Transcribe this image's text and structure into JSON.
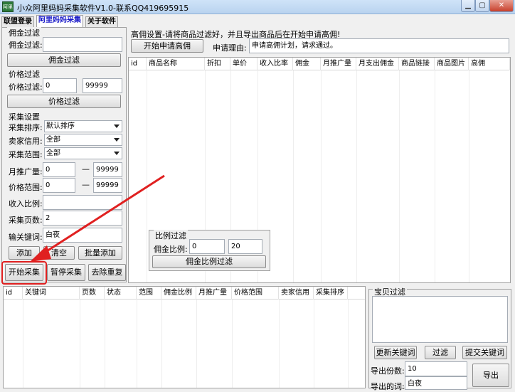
{
  "window": {
    "title": "小众阿里妈妈采集软件V1.0-联系QQ419695915",
    "icon_text": "阿里"
  },
  "tabs": [
    "联盟登录",
    "阿里妈妈采集",
    "关于软件"
  ],
  "commission_filter": {
    "group": "佣金过滤",
    "label": "佣金过滤:",
    "value": "",
    "button": "佣金过滤"
  },
  "price_filter": {
    "group": "价格过滤",
    "label": "价格过滤:",
    "min": "0",
    "max": "99999",
    "button": "价格过滤"
  },
  "collect_settings": {
    "group": "采集设置",
    "sort_label": "采集排序:",
    "sort_value": "默认排序",
    "credit_label": "卖家信用:",
    "credit_value": "全部",
    "scope_label": "采集范围:",
    "scope_value": "全部",
    "promo_label": "月推广量:",
    "promo_min": "0",
    "promo_max": "99999",
    "price_label": "价格范围:",
    "price_min": "0",
    "price_max": "99999",
    "dash": "—",
    "ratio_label": "收入比例:",
    "ratio_value": "",
    "pages_label": "采集页数:",
    "pages_value": "2",
    "keyword_label": "输关键词:",
    "keyword_value": "白夜",
    "add_button": "添加",
    "clear_button": "清空",
    "batch_add_button": "批量添加",
    "start_button": "开始采集",
    "pause_button": "暂停采集",
    "dedupe_button": "去除重复"
  },
  "high_commission": {
    "notice": "高佣设置-请将商品过滤好，并且导出商品后在开始申请高佣!",
    "apply_button": "开始申请高佣",
    "reason_label": "申请理由:",
    "reason_value": "申请高佣计划，请求通过。"
  },
  "product_table": {
    "columns": [
      "id",
      "商品名称",
      "折扣",
      "单价",
      "收入比率",
      "佣金",
      "月推广量",
      "月支出佣金",
      "商品链接",
      "商品图片",
      "高佣"
    ]
  },
  "ratio_filter": {
    "group": "比例过滤",
    "label": "佣金比例:",
    "min": "0",
    "max": "20",
    "button": "佣金比例过滤"
  },
  "keyword_table": {
    "columns": [
      "id",
      "关键词",
      "页数",
      "状态",
      "范围",
      "佣金比例",
      "月推广量",
      "价格范围",
      "卖家信用",
      "采集排序"
    ]
  },
  "item_filter": {
    "group": "宝贝过滤",
    "refresh_button": "更新关键词",
    "filter_button": "过滤",
    "submit_button": "提交关键词",
    "count_label": "导出份数:",
    "count_value": "10",
    "keyword_label": "导出的词:",
    "keyword_value": "白夜",
    "export_button": "导出"
  },
  "colors": {
    "accent_red": "#e02020",
    "active_tab_text": "#1a1ac8"
  }
}
